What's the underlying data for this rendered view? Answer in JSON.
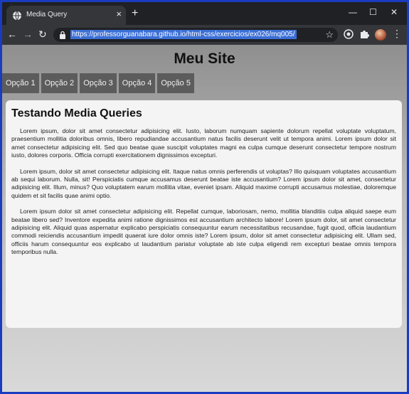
{
  "browser": {
    "tab_title": "Media Query",
    "tab_close": "×",
    "new_tab": "+",
    "url": "https://professorguanabara.github.io/html-css/exercicios/ex026/mq005/",
    "window_controls": {
      "minimize": "—",
      "maximize": "☐",
      "close": "✕"
    },
    "nav": {
      "back": "←",
      "forward": "→",
      "reload": "↻"
    },
    "star": "☆",
    "menu_dots": "⋮",
    "icons": [
      "globe-icon",
      "lock-icon",
      "star-icon",
      "extension-icon",
      "puzzle-icon",
      "avatar"
    ]
  },
  "page": {
    "site_title": "Meu Site",
    "menu": [
      "Opção 1",
      "Opção 2",
      "Opção 3",
      "Opção 4",
      "Opção 5"
    ],
    "article_title": "Testando Media Queries",
    "paragraphs": [
      "Lorem ipsum, dolor sit amet consectetur adipisicing elit. Iusto, laborum numquam sapiente dolorum repellat voluptate voluptatum, praesentium mollitia doloribus omnis, libero repudiandae accusantium natus facilis deserunt velit ut tempora animi. Lorem ipsum dolor sit amet consectetur adipisicing elit. Sed quo beatae quae suscipit voluptates magni ea culpa cumque deserunt consectetur tempore nostrum iusto, dolores corporis. Officia corrupti exercitationem dignissimos excepturi.",
      "Lorem ipsum, dolor sit amet consectetur adipisicing elit. Itaque natus omnis perferendis ut voluptas? Illo quisquam voluptates accusantium ab sequi laborum. Nulla, sit! Perspiciatis cumque accusamus deserunt beatae iste accusantium? Lorem ipsum dolor sit amet, consectetur adipisicing elit. Illum, minus? Quo voluptatem earum mollitia vitae, eveniet ipsam. Aliquid maxime corrupti accusamus molestiae, doloremque quidem et sit facilis quae animi optio.",
      "Lorem ipsum dolor sit amet consectetur adipisicing elit. Repellat cumque, laboriosam, nemo, mollitia blanditiis culpa aliquid saepe eum beatae libero sed? Inventore expedita animi ratione dignissimos est accusantium architecto labore! Lorem ipsum dolor, sit amet consectetur adipisicing elit. Aliquid quas aspernatur explicabo perspiciatis consequuntur earum necessitatibus recusandae, fugit quod, officia laudantium commodi reiciendis accusantium impedit quaerat iure dolor omnis iste? Lorem ipsum, dolor sit amet consectetur adipisicing elit. Ullam sed, officiis harum consequuntur eos explicabo ut laudantium pariatur voluptate ab iste culpa eligendi rem excepturi beatae omnis tempora temporibus nulla."
    ]
  }
}
